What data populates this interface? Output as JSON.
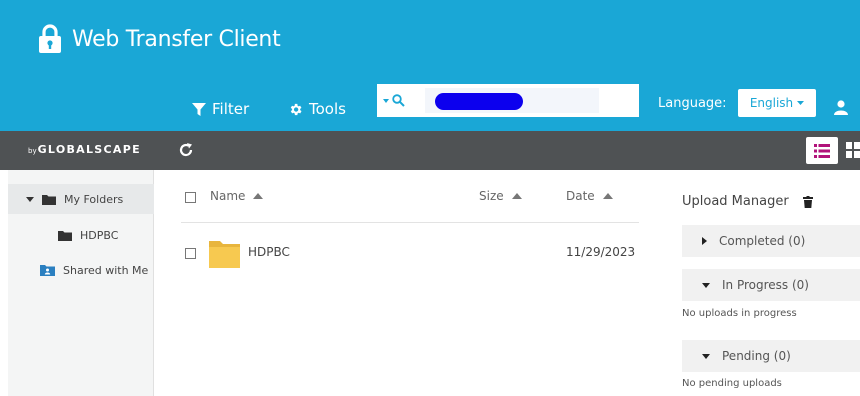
{
  "header": {
    "title": "Web Transfer Client",
    "filter_label": "Filter",
    "tools_label": "Tools",
    "language_label": "Language:",
    "language_value": "English",
    "search": {
      "value": "",
      "placeholder": ""
    },
    "brand_color": "#1aa7d6"
  },
  "toolbar": {
    "logo_prefix": "by",
    "logo": "GLOBALSCAPE",
    "icons": [
      "refresh-icon",
      "list-view-icon",
      "grid-view-icon"
    ]
  },
  "sidebar": {
    "items": [
      {
        "label": "My Folders",
        "icon": "folder-icon",
        "expanded": true
      },
      {
        "label": "HDPBC",
        "icon": "folder-icon"
      },
      {
        "label": "Shared with Me",
        "icon": "shared-folder-icon"
      }
    ]
  },
  "files": {
    "columns": {
      "name": "Name",
      "size": "Size",
      "date": "Date"
    },
    "rows": [
      {
        "name": "HDPBC",
        "size": "",
        "date": "11/29/2023",
        "type": "folder"
      }
    ]
  },
  "upload": {
    "title": "Upload Manager",
    "sections": [
      {
        "label": "Completed (0)",
        "expanded": false
      },
      {
        "label": "In Progress (0)",
        "expanded": true,
        "note": "No uploads in progress"
      },
      {
        "label": "Pending (0)",
        "expanded": true,
        "note": "No pending uploads"
      }
    ]
  }
}
